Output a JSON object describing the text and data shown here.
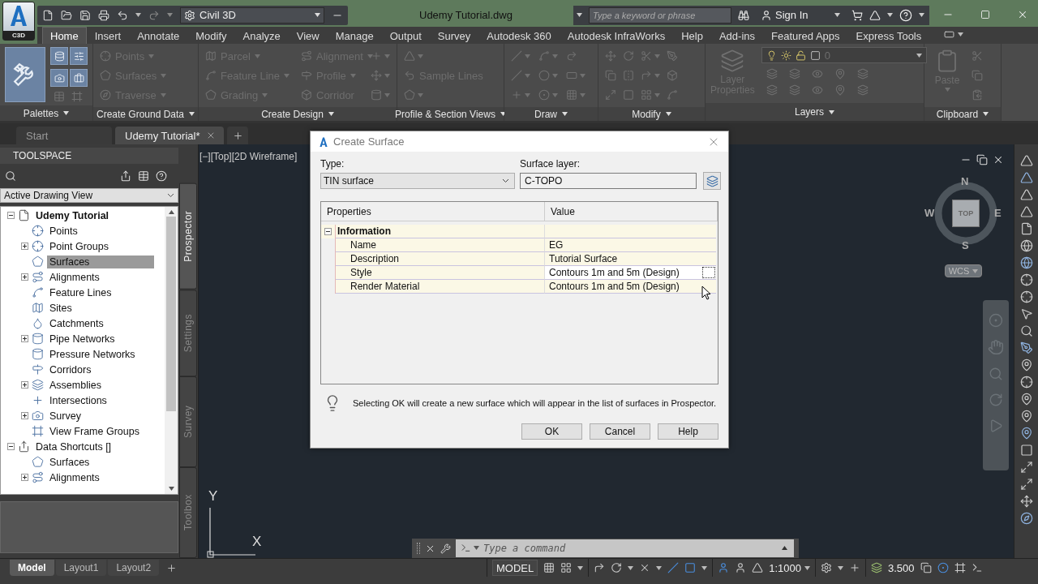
{
  "app": {
    "logo": "C3D",
    "workspace": "Civil 3D",
    "title": "Udemy Tutorial.dwg",
    "search_placeholder": "Type a keyword or phrase",
    "sign_in": "Sign In"
  },
  "ribbon_tabs": [
    {
      "label": "Home",
      "selected": true
    },
    {
      "label": "Insert",
      "selected": false
    },
    {
      "label": "Annotate",
      "selected": false
    },
    {
      "label": "Modify",
      "selected": false
    },
    {
      "label": "Analyze",
      "selected": false
    },
    {
      "label": "View",
      "selected": false
    },
    {
      "label": "Manage",
      "selected": false
    },
    {
      "label": "Output",
      "selected": false
    },
    {
      "label": "Survey",
      "selected": false
    },
    {
      "label": "Autodesk 360",
      "selected": false
    },
    {
      "label": "Autodesk InfraWorks",
      "selected": false
    },
    {
      "label": "Help",
      "selected": false
    },
    {
      "label": "Add-ins",
      "selected": false
    },
    {
      "label": "Featured Apps",
      "selected": false
    },
    {
      "label": "Express Tools",
      "selected": false
    }
  ],
  "ribbon_panels": [
    {
      "kind": "palettes",
      "title": "Palettes"
    },
    {
      "kind": "ground",
      "title": "Create Ground Data",
      "tools": [
        {
          "label": "Points",
          "disabled": true,
          "dropdown": true
        },
        {
          "label": "Surfaces",
          "disabled": true,
          "dropdown": true
        },
        {
          "label": "Traverse",
          "disabled": true,
          "dropdown": true
        }
      ]
    },
    {
      "kind": "design",
      "title": "Create Design",
      "tools": [
        {
          "label": "Parcel",
          "disabled": true,
          "dropdown": true
        },
        {
          "label": "Feature Line",
          "disabled": true,
          "dropdown": true
        },
        {
          "label": "Grading",
          "disabled": true,
          "dropdown": true
        },
        {
          "label": "Alignment",
          "disabled": true,
          "dropdown": true
        },
        {
          "label": "Profile",
          "disabled": true,
          "dropdown": true
        },
        {
          "label": "Corridor",
          "disabled": true,
          "dropdown": false
        }
      ]
    },
    {
      "kind": "profile",
      "title": "Profile & Section Views",
      "tools": [
        {
          "label": "Sample Lines",
          "disabled": true,
          "dropdown": false
        }
      ]
    },
    {
      "kind": "draw",
      "title": "Draw"
    },
    {
      "kind": "modify",
      "title": "Modify"
    },
    {
      "kind": "layers",
      "title": "Layers",
      "layer": "0",
      "tools": [
        {
          "label": "Layer Properties",
          "disabled": true,
          "dropdown": false
        }
      ]
    },
    {
      "kind": "clipboard",
      "title": "Clipboard",
      "tools": [
        {
          "label": "Paste",
          "disabled": true,
          "dropdown": true
        }
      ]
    }
  ],
  "doc_tabs": [
    {
      "label": "Start",
      "selected": false
    },
    {
      "label": "Udemy Tutorial*",
      "selected": true
    }
  ],
  "toolspace": {
    "title": "TOOLSPACE",
    "view": "Active Drawing View",
    "tree": [
      {
        "label": "Udemy Tutorial",
        "active": true,
        "selected": false,
        "has_children": true,
        "expanded": true,
        "children": [
          {
            "label": "Points",
            "selected": false,
            "has_children": false
          },
          {
            "label": "Point Groups",
            "selected": false,
            "has_children": true,
            "expanded": false
          },
          {
            "label": "Surfaces",
            "selected": true,
            "has_children": false
          },
          {
            "label": "Alignments",
            "selected": false,
            "has_children": true,
            "expanded": false
          },
          {
            "label": "Feature Lines",
            "selected": false,
            "has_children": false
          },
          {
            "label": "Sites",
            "selected": false,
            "has_children": false
          },
          {
            "label": "Catchments",
            "selected": false,
            "has_children": false
          },
          {
            "label": "Pipe Networks",
            "selected": false,
            "has_children": true,
            "expanded": false
          },
          {
            "label": "Pressure Networks",
            "selected": false,
            "has_children": false
          },
          {
            "label": "Corridors",
            "selected": false,
            "has_children": false
          },
          {
            "label": "Assemblies",
            "selected": false,
            "has_children": true,
            "expanded": false
          },
          {
            "label": "Intersections",
            "selected": false,
            "has_children": false
          },
          {
            "label": "Survey",
            "selected": false,
            "has_children": true,
            "expanded": false
          },
          {
            "label": "View Frame Groups",
            "selected": false,
            "has_children": false
          }
        ]
      },
      {
        "label": "Data Shortcuts []",
        "active": false,
        "selected": false,
        "has_children": true,
        "expanded": true,
        "children": [
          {
            "label": "Surfaces",
            "selected": false,
            "has_children": false
          },
          {
            "label": "Alignments",
            "selected": false,
            "has_children": true,
            "expanded": false
          }
        ]
      }
    ],
    "side_tabs": [
      {
        "label": "Prospector",
        "selected": true
      },
      {
        "label": "Settings",
        "selected": false
      },
      {
        "label": "Survey",
        "selected": false
      },
      {
        "label": "Toolbox",
        "selected": false
      }
    ]
  },
  "viewport": {
    "label": "[−][Top][2D Wireframe]",
    "north": "N",
    "south": "S",
    "west": "W",
    "east": "E",
    "face": "TOP",
    "ucs": "WCS",
    "axis_x": "X",
    "axis_y": "Y"
  },
  "dialog": {
    "title": "Create Surface",
    "type_label": "Type:",
    "type_value": "TIN surface",
    "layer_label": "Surface layer:",
    "layer_value": "C-TOPO",
    "columns": [
      "Properties",
      "Value"
    ],
    "groups": [
      {
        "label": "Information",
        "expanded": true,
        "rows": [
          {
            "name": "Name",
            "value": "EG",
            "focused": false
          },
          {
            "name": "Description",
            "value": "Tutorial Surface",
            "focused": false
          },
          {
            "name": "Style",
            "value": "Contours 1m and 5m (Design)",
            "focused": true
          },
          {
            "name": "Render Material",
            "value": "Contours 1m and 5m (Design)",
            "focused": false
          }
        ]
      }
    ],
    "note": "Selecting OK will create a new surface which will appear in the list of surfaces in Prospector.",
    "buttons": [
      "OK",
      "Cancel",
      "Help"
    ]
  },
  "command_line": {
    "placeholder": "Type a command"
  },
  "status_bar": {
    "layout_tabs": [
      {
        "label": "Model",
        "selected": true
      },
      {
        "label": "Layout1",
        "selected": false
      },
      {
        "label": "Layout2",
        "selected": false
      }
    ],
    "mode": "MODEL",
    "scale": "1:1000",
    "lineweight": "3.500"
  }
}
